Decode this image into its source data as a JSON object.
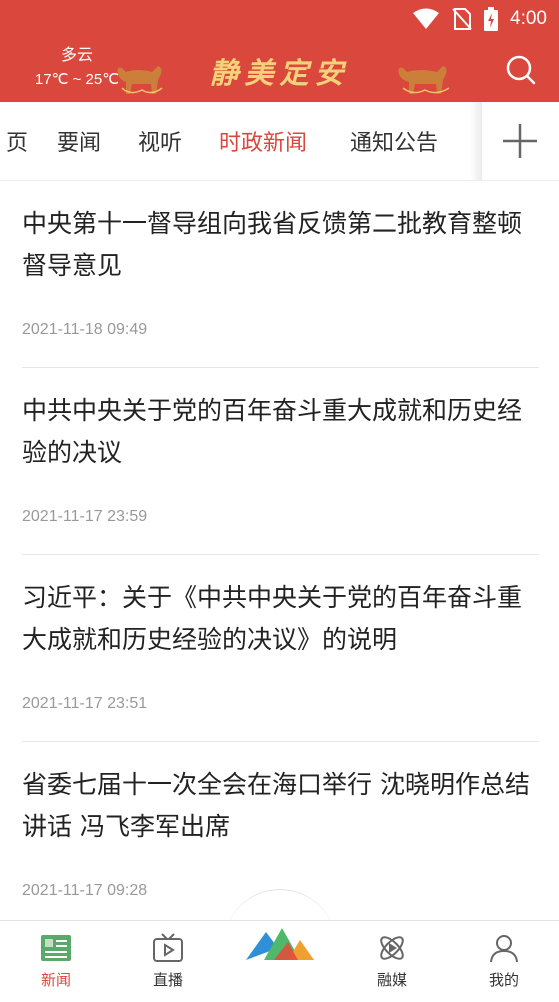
{
  "status_bar": {
    "time": "4:00",
    "icons": [
      "wifi-icon",
      "no-sim-icon",
      "battery-charging-icon"
    ]
  },
  "header": {
    "weather_condition": "多云",
    "temperature_range": "17℃ ~ 25℃",
    "title": "静美定安",
    "search_icon": "search-icon"
  },
  "tabs": {
    "items": [
      "页",
      "要闻",
      "视听",
      "时政新闻",
      "通知公告"
    ],
    "active": "时政新闻",
    "add_icon": "plus-icon"
  },
  "news": [
    {
      "title": "中央第十一督导组向我省反馈第二批教育整顿督导意见",
      "date": "2021-11-18 09:49"
    },
    {
      "title": "中共中央关于党的百年奋斗重大成就和历史经验的决议",
      "date": "2021-11-17 23:59"
    },
    {
      "title": "习近平：关于《中共中央关于党的百年奋斗重大成就和历史经验的决议》的说明",
      "date": "2021-11-17 23:51"
    },
    {
      "title": "省委七届十一次全会在海口举行 沈晓明作总结讲话 冯飞李军出席",
      "date": "2021-11-17 09:28"
    }
  ],
  "bottom_nav": {
    "items": [
      {
        "label": "新闻",
        "icon": "newspaper-icon"
      },
      {
        "label": "直播",
        "icon": "tv-play-icon"
      },
      {
        "label": "",
        "icon": "mountain-logo-icon"
      },
      {
        "label": "融媒",
        "icon": "media-orbit-icon"
      },
      {
        "label": "我的",
        "icon": "user-icon"
      }
    ],
    "active": "新闻"
  },
  "colors": {
    "brand_red": "#d9473d",
    "title_gold": "#f5d27a",
    "text": "#222222",
    "muted": "#999999"
  }
}
